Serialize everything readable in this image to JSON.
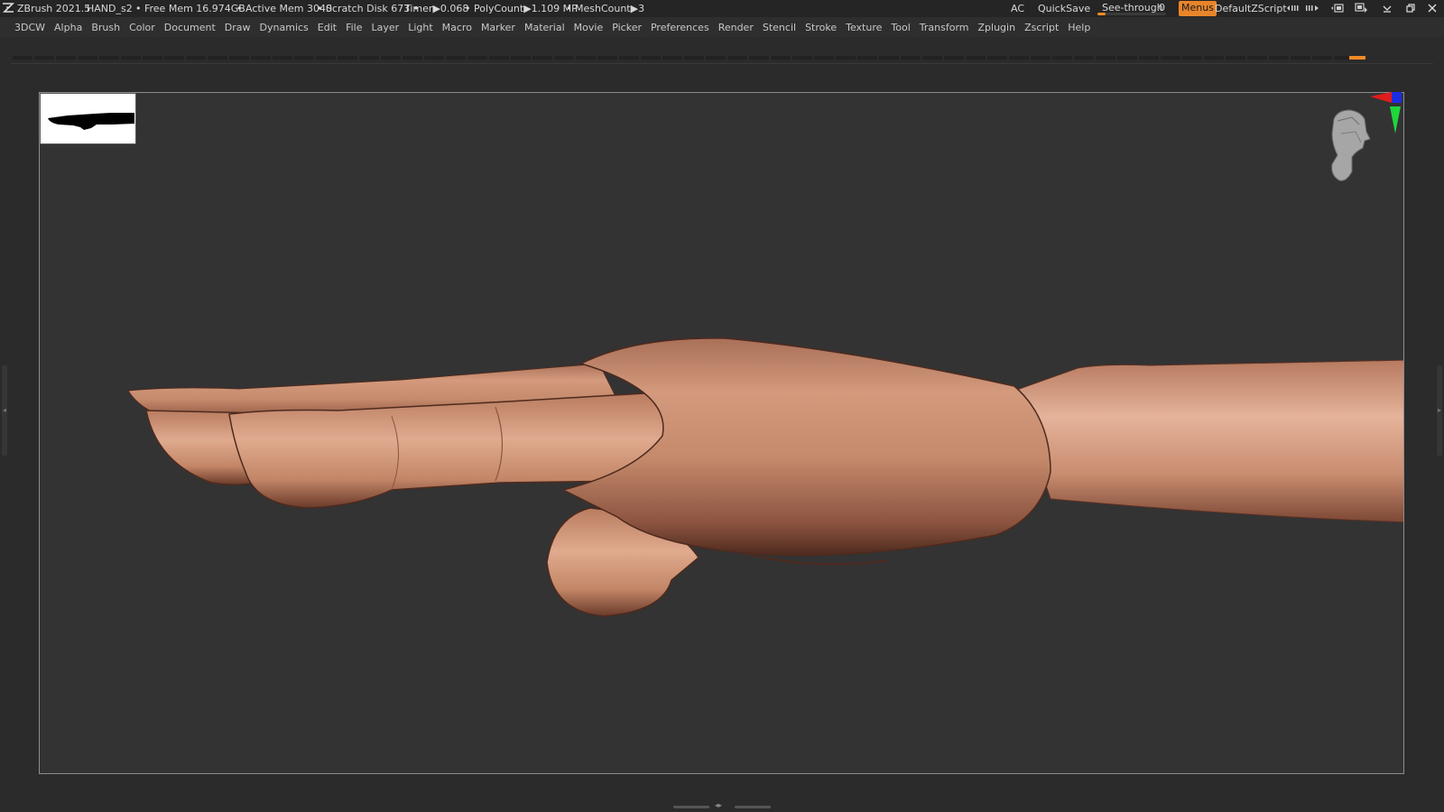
{
  "titlebar": {
    "app": "ZBrush 2021.5",
    "file": "HAND_s2",
    "free_mem": "• Free Mem 16.974GB",
    "active_mem": "• Active Mem 3040",
    "scratch_disk": "• Scratch Disk 673 •",
    "timer": "Timer▶0.068",
    "polycount": "• PolyCount▶1.109 MP",
    "meshcount": "• MeshCount▶3",
    "ac": "AC",
    "quicksave": "QuickSave",
    "see_through_label": "See-through",
    "see_through_value": "0",
    "see_through_level": 0.12,
    "menus": "Menus",
    "script": "DefaultZScript",
    "accent_color": "#f08a24"
  },
  "menubar": {
    "items": [
      "3DCW",
      "Alpha",
      "Brush",
      "Color",
      "Document",
      "Draw",
      "Dynamics",
      "Edit",
      "File",
      "Layer",
      "Light",
      "Macro",
      "Marker",
      "Material",
      "Movie",
      "Picker",
      "Preferences",
      "Render",
      "Stencil",
      "Stroke",
      "Texture",
      "Tool",
      "Transform",
      "Zplugin",
      "Zscript",
      "Help"
    ]
  },
  "canvas": {
    "document_bg": "#333333",
    "model_color": "#c98a6c",
    "model_name": "hand-model",
    "navigator": "navigator-thumbnail",
    "gizmo": "orientation-gizmo"
  },
  "icons": [
    "zbrush-logo-icon",
    "layout-left-icon",
    "layout-right-icon",
    "window-icon",
    "window-swap-icon",
    "minimize-icon",
    "restore-icon",
    "close-icon"
  ]
}
